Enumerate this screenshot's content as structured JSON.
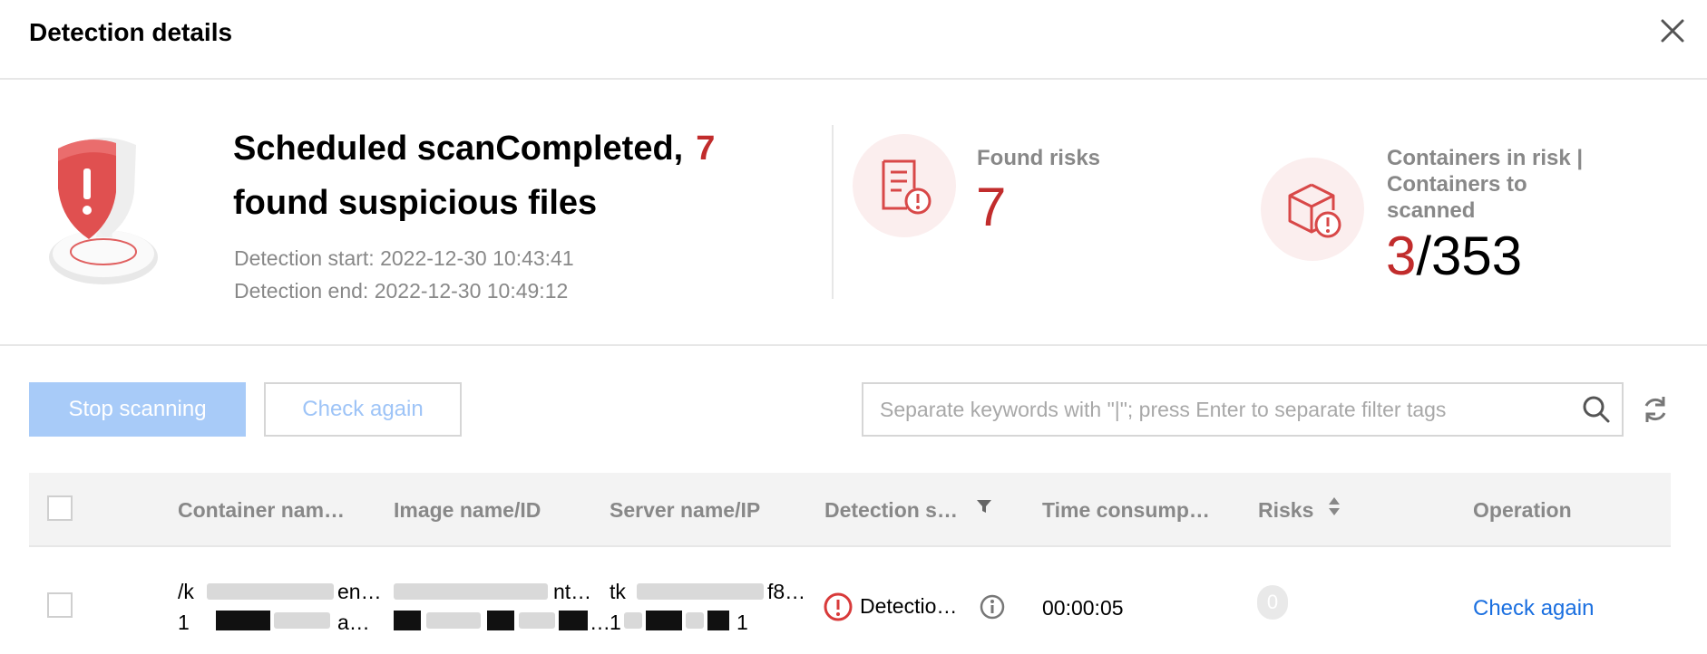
{
  "dialog": {
    "title": "Detection details",
    "close_icon": "close-icon"
  },
  "summary": {
    "headline_prefix": "Scheduled scanCompleted,",
    "suspicious_count": "7",
    "headline_suffix": "found suspicious files",
    "detection_start": "Detection start: 2022-12-30 10:43:41",
    "detection_end": "Detection end: 2022-12-30 10:49:12",
    "found_risks_label": "Found risks",
    "found_risks_value": "7",
    "containers_label": "Containers in risk | Containers to scanned",
    "containers_in_risk": "3",
    "containers_total": "/353",
    "accent_color": "#c12c2c"
  },
  "toolbar": {
    "stop_label": "Stop scanning",
    "check_again_label": "Check again",
    "search_placeholder": "Separate keywords with \"|\"; press Enter to separate filter tags"
  },
  "table": {
    "columns": [
      "Container nam…",
      "Image name/ID",
      "Server name/IP",
      "Detection s…",
      "Time consump…",
      "Risks",
      "Operation"
    ],
    "rows": [
      {
        "container_line1": "/k",
        "container_line1_end": "en…",
        "container_line2": "1",
        "container_line2_end": "a…",
        "image_line1_end": "nt…",
        "image_line2_end": "…",
        "server_line1": "tk",
        "server_line1_end": "f8…",
        "server_line2": "1",
        "server_line2_end": "1",
        "detection_status": "Detectio…",
        "time_consumption": "00:00:05",
        "risks": "0",
        "operation": "Check again"
      }
    ]
  }
}
